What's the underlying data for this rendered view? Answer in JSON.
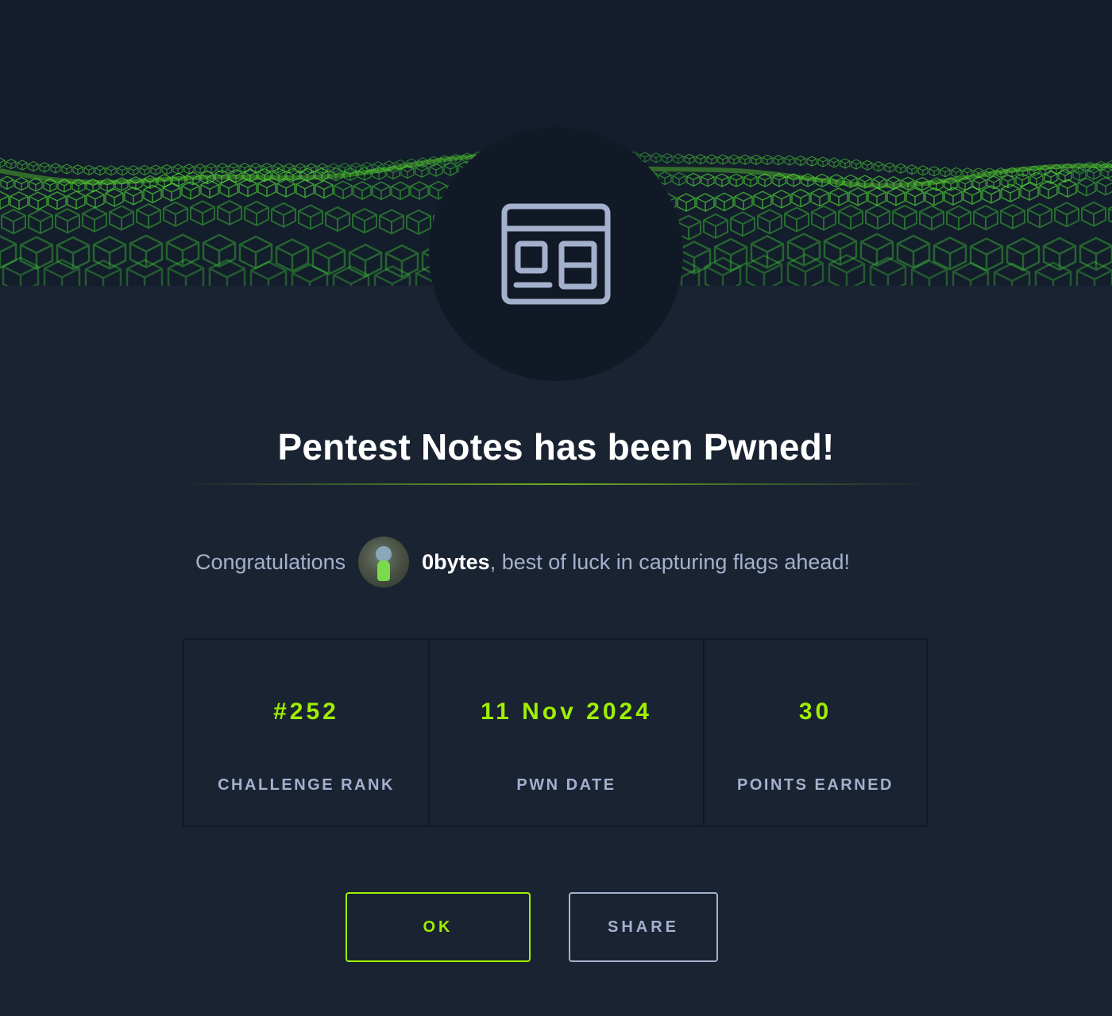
{
  "header": {
    "banner": "green-cube-wave-banner",
    "badge_icon": "web-layout-icon"
  },
  "title": "Pentest Notes has been Pwned!",
  "congrats": {
    "prefix": "Congratulations",
    "avatar": "user-avatar",
    "username": "0bytes",
    "suffix": ", best of luck in capturing flags ahead!"
  },
  "stats": [
    {
      "value": "#252",
      "label": "CHALLENGE RANK"
    },
    {
      "value": "11 Nov 2024",
      "label": "PWN DATE"
    },
    {
      "value": "30",
      "label": "POINTS EARNED"
    }
  ],
  "buttons": {
    "ok": "OK",
    "share": "SHARE"
  },
  "colors": {
    "accent": "#9fef00",
    "background": "#1a2332",
    "muted_text": "#a4b1cd"
  }
}
